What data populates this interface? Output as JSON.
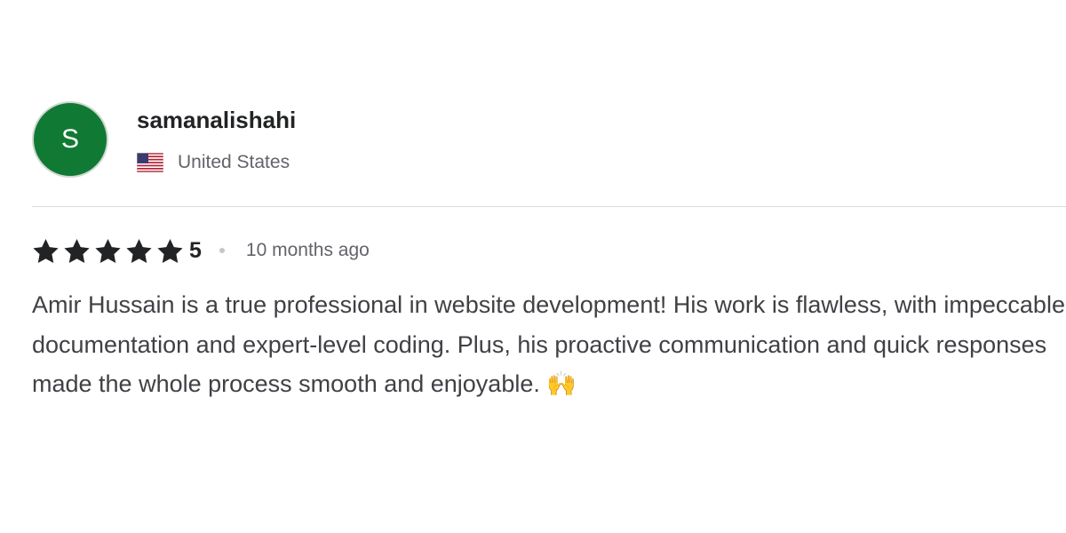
{
  "reviewer": {
    "avatar_letter": "S",
    "avatar_color": "#107a35",
    "username": "samanalishahi",
    "flag_icon": "us-flag-icon",
    "country": "United States"
  },
  "rating": {
    "stars": 5,
    "max_stars": 5,
    "value": "5",
    "star_icon": "star-icon",
    "time_ago": "10 months ago"
  },
  "review": {
    "text": "Amir Hussain is a true professional in website development! His work is flawless, with impeccable documentation and expert-level coding. Plus, his proactive communication and quick responses made the whole process smooth and enjoyable. 🙌"
  }
}
